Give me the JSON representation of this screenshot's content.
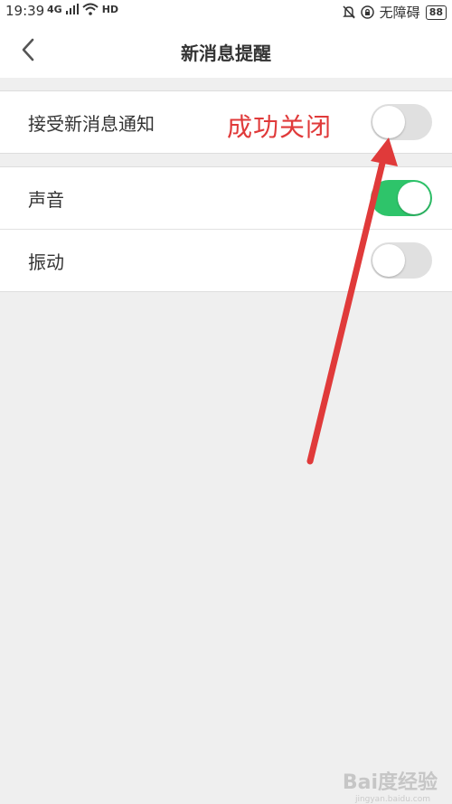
{
  "status_bar": {
    "time": "19:39",
    "network": "4G",
    "hd": "HD",
    "accessibility": "无障碍",
    "battery": "88"
  },
  "header": {
    "title": "新消息提醒"
  },
  "settings": {
    "notifications": {
      "label": "接受新消息通知",
      "enabled": false
    },
    "sound": {
      "label": "声音",
      "enabled": true
    },
    "vibrate": {
      "label": "振动",
      "enabled": false
    }
  },
  "annotation": {
    "text": "成功关闭",
    "color": "#e03a3a"
  },
  "watermark": {
    "text": "Bai度经验",
    "sub": "jingyan.baidu.com"
  },
  "colors": {
    "toggle_on": "#2ec46a",
    "toggle_off": "#e0e0e0",
    "background": "#efefef"
  }
}
